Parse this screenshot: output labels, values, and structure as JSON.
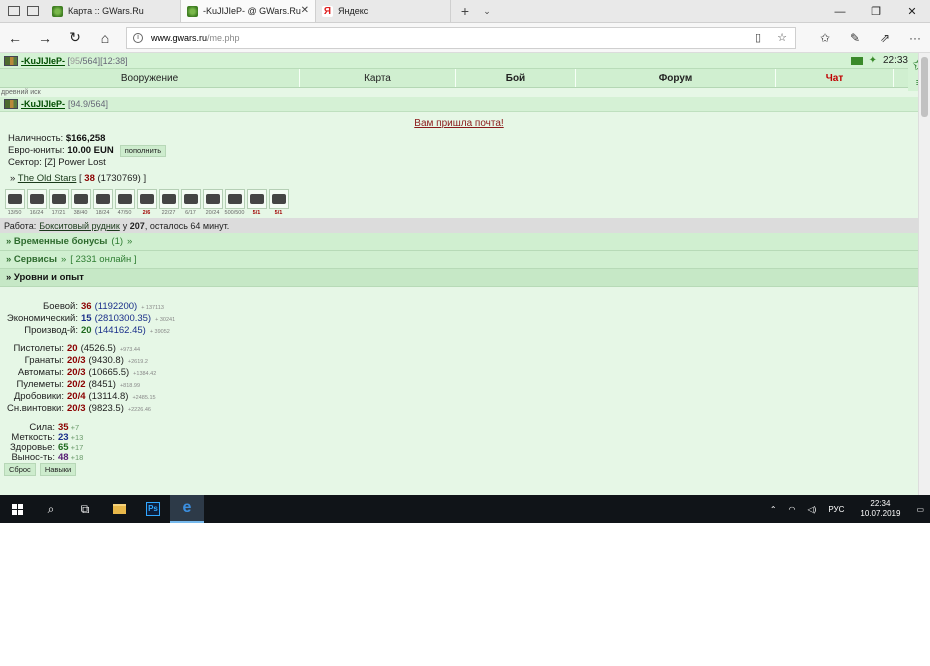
{
  "tabs": [
    {
      "title": "Карта :: GWars.Ru",
      "favicon": "gwars-leaf-icon"
    },
    {
      "title": "-KuJIJIeP- @ GWars.Ru",
      "favicon": "gwars-leaf-icon"
    },
    {
      "title": "Яндекс",
      "favicon": "yandex-icon"
    }
  ],
  "address": {
    "host": "www.gwars.ru",
    "path": "/me.php"
  },
  "top": {
    "nick": "-KuJIJIeP-",
    "hp_cur": "95",
    "hp_rest": "/564][12:38]",
    "time": "22:33"
  },
  "menu": [
    "Вооружение",
    "Карта",
    "Бой",
    "Форум",
    "Чат"
  ],
  "hint": "древний иск",
  "profile": {
    "nick": "-KuJIJIeP-",
    "hp": "[94.9/564]"
  },
  "mail": "Вам пришла почта!",
  "money": {
    "cash_label": "Наличность:",
    "cash": "$166,258",
    "eun_label": "Евро-юниты:",
    "eun": "10.00 EUN",
    "refill": "пополнить",
    "sector_label": "Сектор:",
    "sector": "[Z] Power Lost"
  },
  "clan": {
    "prefix": "»",
    "name": "The Old Stars",
    "lb": "[",
    "num": "38",
    "exp": "(1730769)",
    "rb": "]"
  },
  "items": [
    {
      "icon": "rifle-icon",
      "dur": "13/50"
    },
    {
      "icon": "scope-icon",
      "dur": "16/24"
    },
    {
      "icon": "helmet-icon",
      "dur": "17/21"
    },
    {
      "icon": "armor-vest-icon",
      "dur": "38/40"
    },
    {
      "icon": "camo-suit-icon",
      "dur": "18/24"
    },
    {
      "icon": "boots-icon",
      "dur": "47/50"
    },
    {
      "icon": "car-icon",
      "dur": "2/6",
      "red": true
    },
    {
      "icon": "phone-icon",
      "dur": "22/27"
    },
    {
      "icon": "disc-icon",
      "dur": "6/17"
    },
    {
      "icon": "pistol-icon",
      "dur": "20/24"
    },
    {
      "icon": "camo-cloak-icon",
      "dur": "500/500"
    },
    {
      "icon": "grenade-icon",
      "dur": "5/1",
      "red": true
    },
    {
      "icon": "grenade-icon",
      "dur": "5/1",
      "red": true
    }
  ],
  "work": {
    "label": "Работа:",
    "place": "Бокситовый рудник",
    "mid": "у",
    "num": "207",
    "rest": ", осталось 64 минут."
  },
  "sections": {
    "bonus": "» Временные бонусы",
    "bonus_count": "(1)",
    "services": "» Сервисы",
    "online": "[ 2331 онлайн ]",
    "levels": "» Уровни и опыт"
  },
  "levels": [
    {
      "label": "Боевой:",
      "val": "36",
      "sub": "(1192200)",
      "exp": "+ 137113",
      "color": "red"
    },
    {
      "label": "Экономический:",
      "val": "15",
      "sub": "(2810300.35)",
      "exp": "+ 30241",
      "color": "blue"
    },
    {
      "label": "Производ-й:",
      "val": "20",
      "sub": "(144162.45)",
      "exp": "+ 39052",
      "color": "green"
    }
  ],
  "skills": [
    {
      "label": "Пистолеты:",
      "val": "20",
      "sub": "(4526.5)",
      "exp": "+973.44"
    },
    {
      "label": "Гранаты:",
      "val": "20/3",
      "sub": "(9430.8)",
      "exp": "+2619.2"
    },
    {
      "label": "Автоматы:",
      "val": "20/3",
      "sub": "(10665.5)",
      "exp": "+1384.42"
    },
    {
      "label": "Пулеметы:",
      "val": "20/2",
      "sub": "(8451)",
      "exp": "+818.99"
    },
    {
      "label": "Дробовики:",
      "val": "20/4",
      "sub": "(13114.8)",
      "exp": "+2485.15"
    },
    {
      "label": "Сн.винтовки:",
      "val": "20/3",
      "sub": "(9823.5)",
      "exp": "+2226.46"
    }
  ],
  "attrs": [
    {
      "label": "Сила:",
      "val": "35",
      "plus": "+7",
      "color": "red"
    },
    {
      "label": "Меткость:",
      "val": "23",
      "plus": "+13",
      "color": "blue"
    },
    {
      "label": "Здоровье:",
      "val": "65",
      "plus": "+17",
      "color": "green"
    },
    {
      "label": "Вынос-ть:",
      "val": "48",
      "plus": "+18",
      "color": "purple"
    }
  ],
  "buttons": {
    "reset": "Сброс",
    "skills": "Навыки"
  },
  "tray": {
    "lang": "РУС",
    "time": "22:34",
    "date": "10.07.2019"
  }
}
